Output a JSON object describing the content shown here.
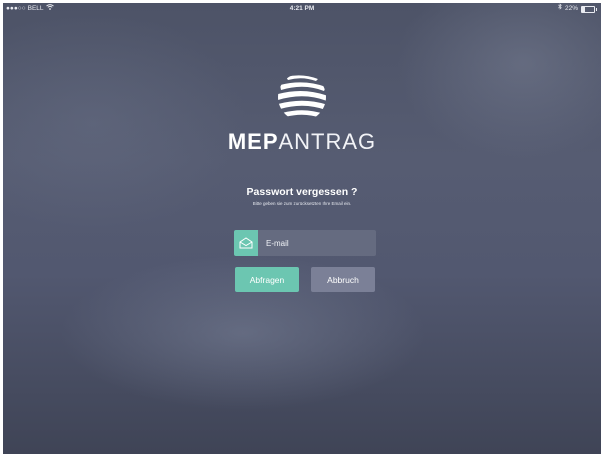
{
  "statusbar": {
    "signal": "●●●○○",
    "carrier": "BELL",
    "time": "4:21 PM",
    "battery_text": "22%",
    "battery_level": 0.22
  },
  "brand": {
    "part1": "MEP",
    "part2": "ANTRAG"
  },
  "forgot": {
    "title": "Passwort vergessen ?",
    "subtitle": "Bitte geben sie zum zurücksetzten Ihre Email ein."
  },
  "form": {
    "email_placeholder": "E-mail",
    "email_value": "",
    "submit_label": "Abfragen",
    "cancel_label": "Abbruch"
  },
  "colors": {
    "accent": "#6cc6b1",
    "secondary_button": "#7b8097",
    "input_bg": "#656b80"
  },
  "icons": {
    "logo": "striped-globe-icon",
    "email": "envelope-icon",
    "wifi": "wifi-icon",
    "bluetooth": "bluetooth-icon",
    "battery": "battery-icon"
  }
}
